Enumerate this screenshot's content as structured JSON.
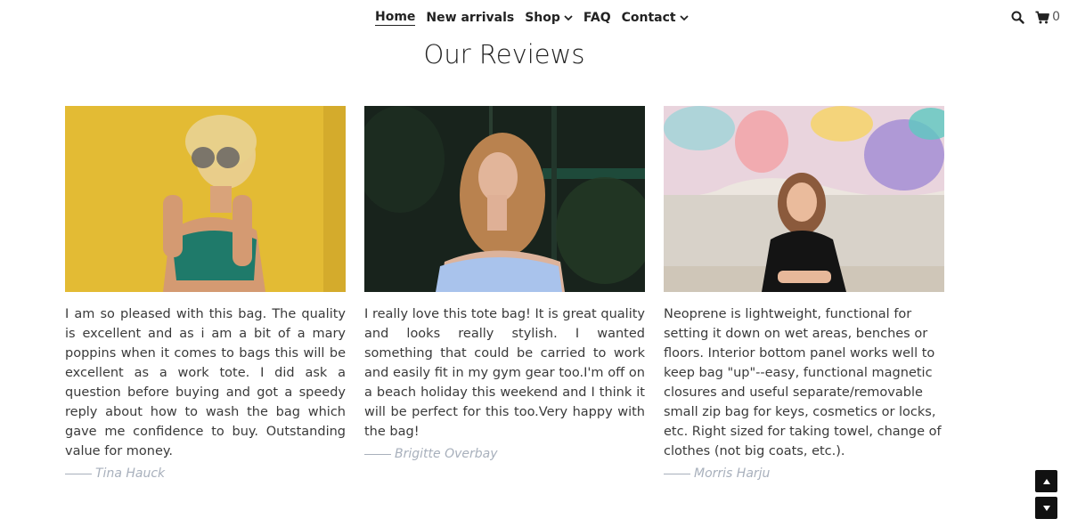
{
  "nav": {
    "links": [
      {
        "label": "Home"
      },
      {
        "label": "New arrivals"
      },
      {
        "label": "Shop"
      },
      {
        "label": "FAQ"
      },
      {
        "label": "Contact"
      }
    ],
    "cart_count": "0"
  },
  "page_title": "Our Reviews",
  "reviews": [
    {
      "text": "I am so pleased with this bag. The quality is excellent and as i am a bit of a mary poppins when it comes to bags this will be excellent as a work tote. I did ask a question before buying and got a speedy reply about how to wash the bag which gave me confidence to buy. Outstanding value for money.",
      "author": "Tina Hauck"
    },
    {
      "text": "I really love this tote bag! It is great quality and looks really stylish. I wanted something that could be carried to work and easily fit in my gym gear too.I'm off on a beach holiday this weekend and I think it will be perfect for this too.Very happy with the bag!",
      "author": "Brigitte Overbay"
    },
    {
      "text": "Neoprene is lightweight, functional for setting it down on wet areas, benches or floors. Interior bottom panel works well to keep bag \"up\"--easy, functional magnetic closures and useful separate/removable small zip bag for keys, cosmetics or locks, etc. Right sized for taking towel, change of clothes (not big coats, etc.).",
      "author": "Morris Harju"
    }
  ],
  "colors": {
    "author": "#a8b0bc",
    "text": "#3a3a3a",
    "scroll_button": "#111111"
  },
  "icons": [
    "search-icon",
    "cart-icon",
    "chevron-down-icon",
    "arrow-up-icon",
    "arrow-down-icon"
  ]
}
